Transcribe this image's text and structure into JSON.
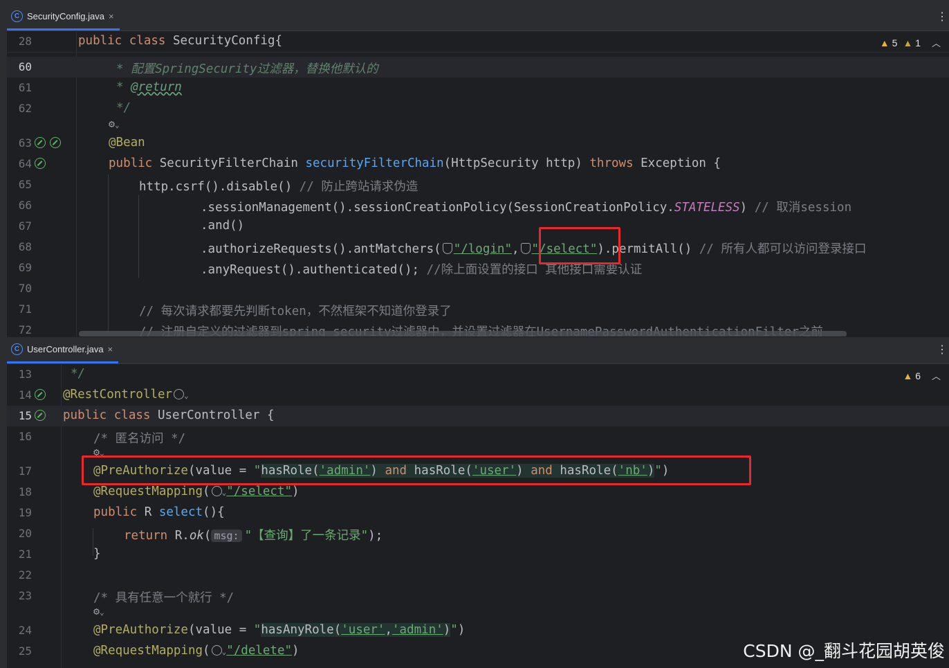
{
  "top_pane": {
    "tab": {
      "label": "SecurityConfig.java",
      "icon": "java-class-icon",
      "close": "×"
    },
    "inspections": {
      "warnings": "5",
      "weak_warnings": "1"
    },
    "lines": [
      {
        "n": "28",
        "text": "public class SecurityConfig{"
      },
      {
        "n": "60",
        "text": "* 配置SpringSecurity过滤器，替换他默认的"
      },
      {
        "n": "61",
        "star": "* ",
        "tag": "@return"
      },
      {
        "n": "62",
        "text": "*/"
      },
      {
        "n": "63",
        "text": "@Bean"
      },
      {
        "n": "64",
        "kw1": "public",
        "type": " SecurityFilterChain ",
        "method": "securityFilterChain",
        "params": "(HttpSecurity http) ",
        "kw2": "throws",
        "rest": " Exception {"
      },
      {
        "n": "65",
        "code": "http.csrf().disable() ",
        "comment": "// 防止跨站请求伪造"
      },
      {
        "n": "66",
        "code": ".sessionManagement().sessionCreationPolicy(SessionCreationPolicy.",
        "static": "STATELESS",
        "close": ") ",
        "comment": "// 取消session"
      },
      {
        "n": "67",
        "code": ".and()"
      },
      {
        "n": "68",
        "code": ".authorizeRequests().antMatchers(",
        "s1": "\"/login\"",
        "comma": ",",
        "s2": "\"/select\"",
        "rest": ").permitAll() ",
        "comment": "// 所有人都可以访问登录接口"
      },
      {
        "n": "69",
        "code": ".anyRequest().authenticated(); ",
        "comment": "//除上面设置的接口 其他接口需要认证"
      },
      {
        "n": "70",
        "code": ""
      },
      {
        "n": "71",
        "comment": "// 每次请求都要先判断token，不然框架不知道你登录了"
      },
      {
        "n": "72",
        "comment": "// 注册自定义的过滤器到spring security过滤器中，并设置过滤器在UsernamePasswordAuthenticationFilter之前"
      }
    ]
  },
  "bottom_pane": {
    "tab": {
      "label": "UserController.java",
      "icon": "java-class-icon",
      "close": "×"
    },
    "inspections": {
      "weak_warnings": "6"
    },
    "lines": [
      {
        "n": "13",
        "comment": "*/"
      },
      {
        "n": "14",
        "ann": "@RestController"
      },
      {
        "n": "15",
        "kw": "public class",
        "rest": " UserController {"
      },
      {
        "n": "16",
        "comment": "/* 匿名访问 */"
      },
      {
        "n": "17",
        "ann": "@PreAuthorize",
        "p1": "(value = ",
        "q": "\"",
        "e1": "hasRole(",
        "a1": "'admin'",
        "e2": ") ",
        "and1": "and",
        "e3": " hasRole(",
        "a2": "'user'",
        "e4": ") ",
        "and2": "and",
        "e5": " hasRole(",
        "a3": "'nb'",
        "e6": ")",
        "q2": "\"",
        "p2": ")"
      },
      {
        "n": "18",
        "ann": "@RequestMapping",
        "p1": "(",
        "str": "\"/select\"",
        "p2": ")"
      },
      {
        "n": "19",
        "kw": "public",
        "type": " R ",
        "method": "select",
        "rest": "(){"
      },
      {
        "n": "20",
        "kw": "return",
        "r": " R.",
        "m": "ok",
        "p1": "(",
        "hint": "msg:",
        "str": "\"【查询】了一条记录\"",
        "p2": ");"
      },
      {
        "n": "21",
        "code": "}"
      },
      {
        "n": "22",
        "code": ""
      },
      {
        "n": "23",
        "comment": "/* 具有任意一个就行 */"
      },
      {
        "n": "24",
        "ann": "@PreAuthorize",
        "p1": "(value = ",
        "q": "\"",
        "e1": "hasAnyRole(",
        "a1": "'user'",
        "c": ",",
        "a2": "'admin'",
        "e2": ")",
        "q2": "\"",
        "p2": ")"
      },
      {
        "n": "25",
        "ann": "@RequestMapping",
        "p1": "(",
        "str": "\"/delete\"",
        "p2": ")"
      }
    ]
  },
  "watermark": "CSDN @_翻斗花园胡英俊",
  "colors": {
    "highlight_box": "#e8292b",
    "background": "#1e1f22",
    "keyword": "#cf8e6d",
    "string": "#6aab73",
    "annotation": "#b3ae60",
    "method": "#56a8f5"
  }
}
